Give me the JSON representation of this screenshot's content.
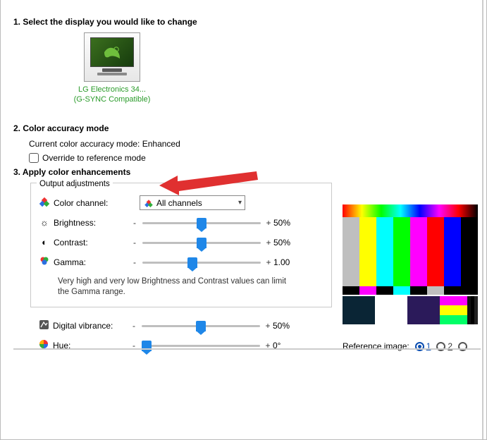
{
  "section1": {
    "title": "1. Select the display you would like to change",
    "monitor_name": "LG Electronics 34...",
    "monitor_sub": "(G-SYNC Compatible)"
  },
  "section2": {
    "title": "2. Color accuracy mode",
    "current": "Current color accuracy mode: Enhanced",
    "override": "Override to reference mode"
  },
  "section3": {
    "title": "3. Apply color enhancements",
    "group_label": "Output adjustments",
    "channel_label": "Color channel:",
    "channel_value": "All channels",
    "brightness": {
      "label": "Brightness:",
      "value": "50%",
      "pos": 50
    },
    "contrast": {
      "label": "Contrast:",
      "value": "50%",
      "pos": 50
    },
    "gamma": {
      "label": "Gamma:",
      "value": "1.00",
      "pos": 42
    },
    "note": "Very high and very low Brightness and Contrast values can limit the Gamma range.",
    "vibrance": {
      "label": "Digital vibrance:",
      "value": "50%",
      "pos": 50
    },
    "hue": {
      "label": "Hue:",
      "value": "0°",
      "pos": 4
    }
  },
  "preview": {
    "ref_label": "Reference image:",
    "opt1": "1",
    "opt2": "2"
  },
  "glyph": {
    "minus": "-",
    "plus": "+"
  }
}
